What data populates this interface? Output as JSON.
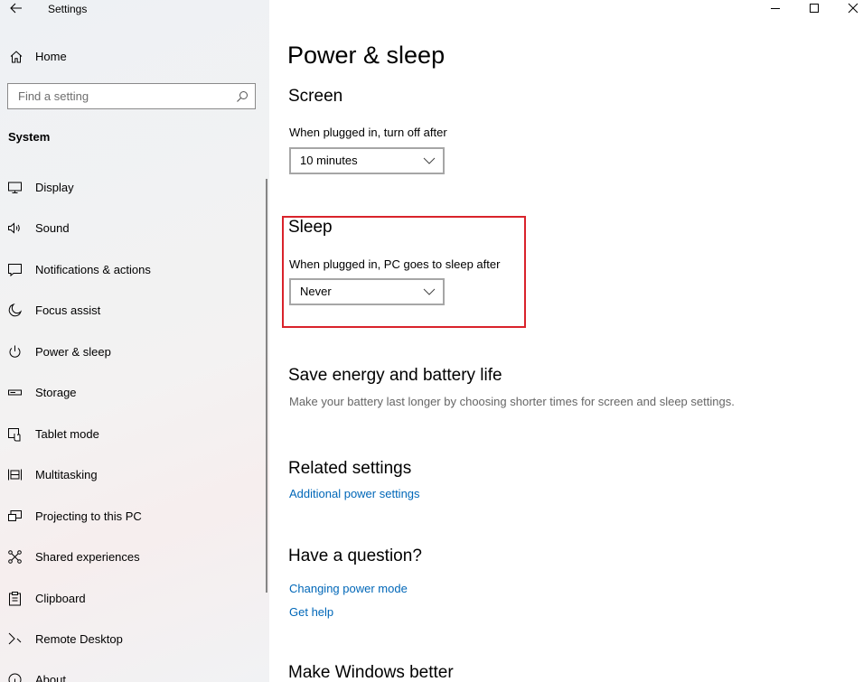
{
  "window": {
    "app_title": "Settings"
  },
  "sidebar": {
    "home_label": "Home",
    "search": {
      "placeholder": "Find a setting",
      "value": ""
    },
    "section_label": "System",
    "items": [
      {
        "label": "Display",
        "icon": "monitor-icon"
      },
      {
        "label": "Sound",
        "icon": "speaker-icon"
      },
      {
        "label": "Notifications & actions",
        "icon": "notification-icon"
      },
      {
        "label": "Focus assist",
        "icon": "moon-icon"
      },
      {
        "label": "Power & sleep",
        "icon": "power-icon"
      },
      {
        "label": "Storage",
        "icon": "storage-icon"
      },
      {
        "label": "Tablet mode",
        "icon": "tablet-mode-icon"
      },
      {
        "label": "Multitasking",
        "icon": "multitasking-icon"
      },
      {
        "label": "Projecting to this PC",
        "icon": "projecting-icon"
      },
      {
        "label": "Shared experiences",
        "icon": "shared-experiences-icon"
      },
      {
        "label": "Clipboard",
        "icon": "clipboard-icon"
      },
      {
        "label": "Remote Desktop",
        "icon": "remote-desktop-icon"
      },
      {
        "label": "About",
        "icon": "info-icon"
      }
    ]
  },
  "main": {
    "title": "Power & sleep",
    "screen": {
      "heading": "Screen",
      "label": "When plugged in, turn off after",
      "value": "10 minutes"
    },
    "sleep": {
      "heading": "Sleep",
      "label": "When plugged in, PC goes to sleep after",
      "value": "Never",
      "highlight_color": "#d9232b"
    },
    "save_energy": {
      "heading": "Save energy and battery life",
      "description": "Make your battery last longer by choosing shorter times for screen and sleep settings."
    },
    "related": {
      "heading": "Related settings",
      "link": "Additional power settings"
    },
    "question": {
      "heading": "Have a question?",
      "links": [
        "Changing power mode",
        "Get help"
      ]
    },
    "better": {
      "heading": "Make Windows better"
    }
  },
  "colors": {
    "link": "#0067b8",
    "highlight": "#d9232b"
  }
}
